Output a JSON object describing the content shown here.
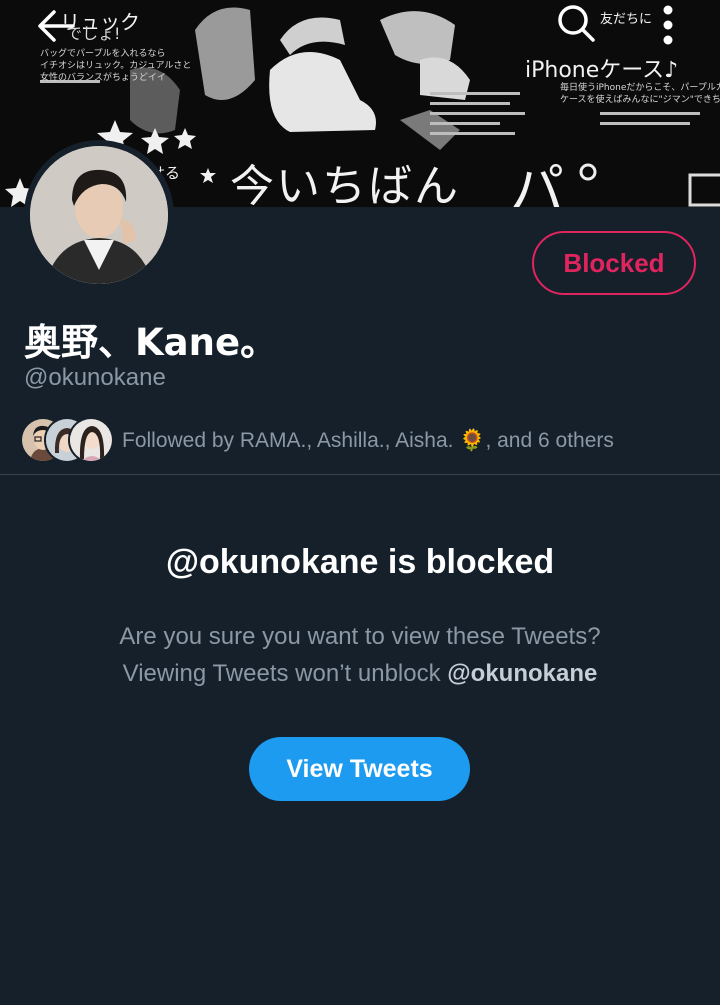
{
  "banner": {
    "text_main": "今いちばん",
    "text_pa": "パ",
    "text_phone": "iPhoneケース♪",
    "text_top": "リュック",
    "text_yes": "でしょ!",
    "text_friends": "友だちに",
    "text_small_left": "バッグでパープルを入れるなら\nイチオシはリュック。カジュアルさと\n女性のバランスがちょうどイイ",
    "text_small_right": "毎日使うiPhoneだからこそ、パープルカラーの\nケースを使えばみんなに\"ジマン\"できちゃう",
    "text_side": "せる"
  },
  "nav": {
    "back_icon": "arrow-left-icon",
    "search_icon": "search-icon",
    "more_icon": "more-vertical-icon"
  },
  "profile": {
    "display_name": "奥野、Kane。",
    "handle": "@okunokane",
    "blocked_button": "Blocked",
    "followed_by": "Followed by RAMA., Ashilla., Aisha. 🌻, and 6 others"
  },
  "blocked_notice": {
    "title": "@okunokane is blocked",
    "line1": "Are you sure you want to view these Tweets?",
    "line2_prefix": "Viewing Tweets won’t unblock ",
    "line2_handle": "@okunokane",
    "view_button": "View Tweets"
  },
  "colors": {
    "background": "#15202b",
    "blocked_red": "#e0245e",
    "accent_blue": "#1d9bf0",
    "secondary_text": "#8b98a5",
    "divider": "#38444d"
  }
}
